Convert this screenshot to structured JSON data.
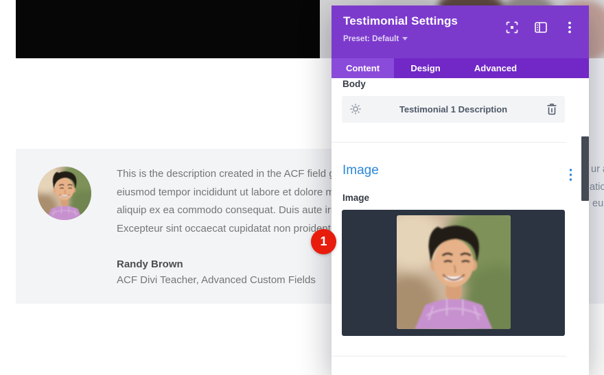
{
  "overlay_badge": {
    "label": "1"
  },
  "page": {
    "testimonial": {
      "lines": [
        "This is the description created in the ACF field gr",
        "eiusmod tempor incididunt ut labore et dolore m",
        "aliquip ex ea commodo consequat. Duis aute iru",
        "Excepteur sint occaecat cupidatat non proident,"
      ],
      "name": "Randy Brown",
      "role": "ACF Divi Teacher, Advanced Custom Fields",
      "edge_fragments": [
        "ur a",
        "atio",
        "eu"
      ]
    }
  },
  "panel": {
    "title": "Testimonial Settings",
    "preset": "Preset: Default",
    "tabs": [
      {
        "label": "Content",
        "active": true
      },
      {
        "label": "Design",
        "active": false
      },
      {
        "label": "Advanced",
        "active": false
      }
    ],
    "header_icons": [
      "focus-icon",
      "split-view-icon",
      "kebab-menu-icon"
    ],
    "body": {
      "label": "Body",
      "field_value": "Testimonial 1 Description"
    },
    "image": {
      "heading": "Image",
      "label": "Image"
    },
    "colors": {
      "header_purple": "#7c3acd",
      "tab_bar_purple": "#7128c6",
      "active_tab_purple": "#8a4bda",
      "accent_blue": "#2b87da",
      "badge_red": "#e81c0d",
      "image_box_dark": "#2b3440"
    }
  }
}
